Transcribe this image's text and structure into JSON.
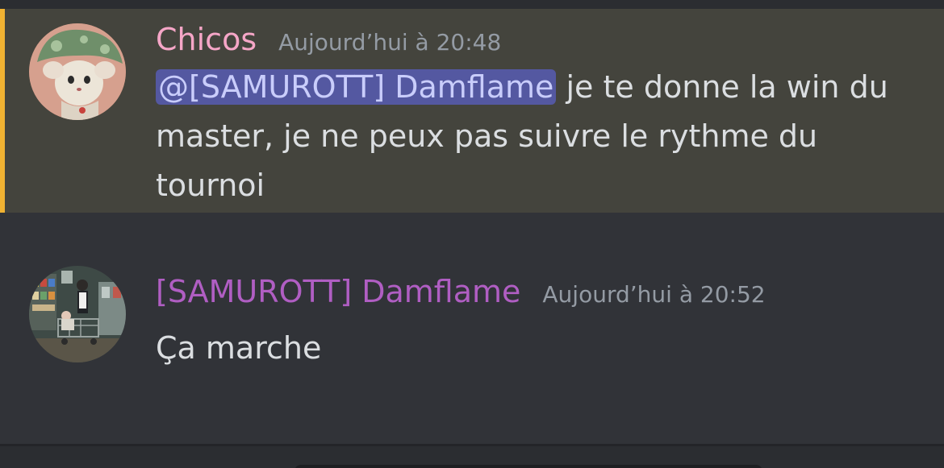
{
  "messages": [
    {
      "author": "Chicos",
      "author_color": "#f5a6c7",
      "timestamp": "Aujourd’hui à 20:48",
      "mention": "@[SAMUROTT] Damflame",
      "text": " je te donne la win du master, je ne peux pas suivre le rythme du tournoi",
      "highlighted": true,
      "avatar_icon": "mouse-mushroom-avatar-icon"
    },
    {
      "author": "[SAMUROTT] Damflame",
      "author_color": "#b05ec3",
      "timestamp": "Aujourd’hui à 20:52",
      "text": "Ça marche",
      "highlighted": false,
      "avatar_icon": "shopping-scene-avatar-icon"
    }
  ],
  "colors": {
    "background": "#313338",
    "highlight_background": "#44443d",
    "highlight_bar": "#f0b232",
    "mention_background": "#5458a1",
    "mention_text": "#c9cdfb",
    "timestamp": "#949ba4",
    "message_text": "#dbdee1"
  }
}
